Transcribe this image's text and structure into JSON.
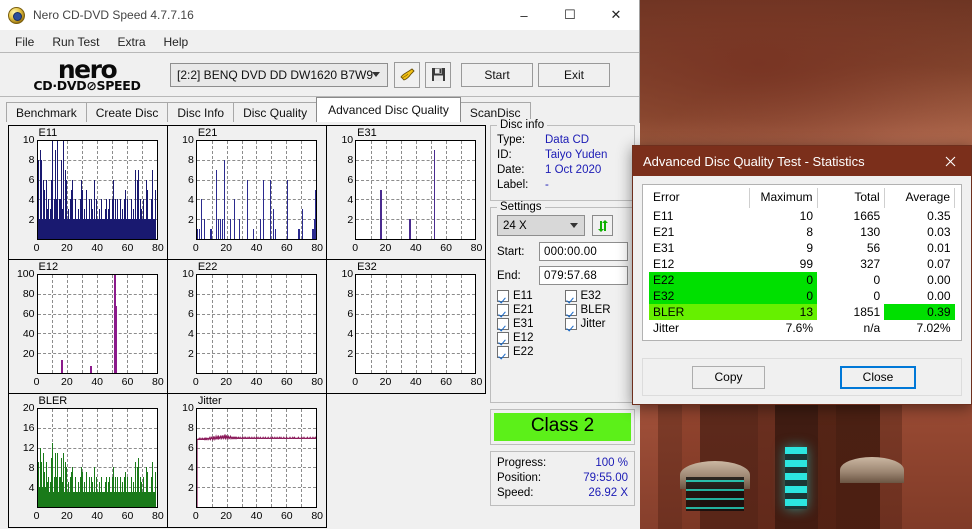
{
  "window": {
    "title": "Nero CD-DVD Speed 4.7.7.16",
    "icon": "nero-disc-icon",
    "minimize": "–",
    "maximize": "☐",
    "close": "✕"
  },
  "menubar": {
    "items": [
      "File",
      "Run Test",
      "Extra",
      "Help"
    ]
  },
  "toolbar": {
    "logo_line1": "nero",
    "logo_line2": "CD·DVD⊘SPEED",
    "drive": "[2:2]   BENQ DVD DD DW1620 B7W9",
    "icons": [
      "disc-scan-icon",
      "save-floppy-icon"
    ],
    "start_label": "Start",
    "exit_label": "Exit"
  },
  "tabs": [
    {
      "label": "Benchmark",
      "active": false
    },
    {
      "label": "Create Disc",
      "active": false
    },
    {
      "label": "Disc Info",
      "active": false
    },
    {
      "label": "Disc Quality",
      "active": false
    },
    {
      "label": "Advanced Disc Quality",
      "active": true
    },
    {
      "label": "ScanDisc",
      "active": false
    }
  ],
  "disc_info": {
    "legend": "Disc info",
    "rows": [
      {
        "key": "Type:",
        "value": "Data CD"
      },
      {
        "key": "ID:",
        "value": "Taiyo Yuden"
      },
      {
        "key": "Date:",
        "value": "1 Oct 2020"
      },
      {
        "key": "Label:",
        "value": "-"
      }
    ]
  },
  "settings": {
    "legend": "Settings",
    "speed": "24 X",
    "refresh_icon": "refresh-arrows-icon",
    "start_label": "Start:",
    "start_value": "000:00.00",
    "end_label": "End:",
    "end_value": "079:57.68",
    "checkboxes": [
      {
        "label": "E11",
        "checked": true
      },
      {
        "label": "E32",
        "checked": true
      },
      {
        "label": "E21",
        "checked": true
      },
      {
        "label": "BLER",
        "checked": true
      },
      {
        "label": "E31",
        "checked": true
      },
      {
        "label": "Jitter",
        "checked": true
      },
      {
        "label": "E12",
        "checked": true
      },
      {
        "label": "",
        "checked": null
      },
      {
        "label": "E22",
        "checked": true
      },
      {
        "label": "",
        "checked": null
      }
    ]
  },
  "class_box": {
    "label": "Class 2",
    "color": "#5cf019"
  },
  "progress_panel": {
    "rows": [
      {
        "key": "Progress:",
        "value": "100 %"
      },
      {
        "key": "Position:",
        "value": "79:55.00"
      },
      {
        "key": "Speed:",
        "value": "26.92 X"
      }
    ]
  },
  "stats_dialog": {
    "title": "Advanced Disc Quality Test - Statistics",
    "close_icon": "close-icon",
    "headers": [
      "Error",
      "Maximum",
      "Total",
      "Average"
    ],
    "rows": [
      {
        "error": "E11",
        "maximum": "10",
        "total": "1665",
        "average": "0.35",
        "hl": "none"
      },
      {
        "error": "E21",
        "maximum": "8",
        "total": "130",
        "average": "0.03",
        "hl": "none"
      },
      {
        "error": "E31",
        "maximum": "9",
        "total": "56",
        "average": "0.01",
        "hl": "none"
      },
      {
        "error": "E12",
        "maximum": "99",
        "total": "327",
        "average": "0.07",
        "hl": "none"
      },
      {
        "error": "E22",
        "maximum": "0",
        "total": "0",
        "average": "0.00",
        "hl": "left"
      },
      {
        "error": "E32",
        "maximum": "0",
        "total": "0",
        "average": "0.00",
        "hl": "left"
      },
      {
        "error": "BLER",
        "maximum": "13",
        "total": "1851",
        "average": "0.39",
        "hl": "bler"
      },
      {
        "error": "Jitter",
        "maximum": "7.6%",
        "total": "n/a",
        "average": "7.02%",
        "hl": "none"
      }
    ],
    "copy_label": "Copy",
    "close_label": "Close"
  },
  "chart_data": [
    {
      "id": "e11",
      "type": "bar",
      "title": "E11",
      "color": "#191970",
      "xlabel": "",
      "ylabel": "",
      "xlim": [
        0,
        80
      ],
      "ylim": [
        0,
        10
      ],
      "yticks": [
        2,
        4,
        6,
        8,
        10
      ],
      "xticks": [
        0,
        20,
        40,
        60,
        80
      ],
      "grid": true,
      "values": [
        4,
        8,
        2,
        2,
        9,
        7,
        8,
        2,
        2,
        2,
        6,
        2,
        1,
        5,
        2,
        2,
        2,
        6,
        2,
        3,
        4,
        4,
        2,
        2,
        3,
        2,
        6,
        2,
        2,
        10,
        2,
        2,
        4,
        2,
        9,
        4,
        2,
        2,
        10,
        2,
        2,
        1,
        4,
        2,
        4,
        2,
        8,
        3,
        2,
        2,
        10,
        2,
        2,
        7,
        2,
        2,
        6,
        2,
        2,
        1,
        3,
        2,
        2,
        4,
        5,
        2,
        2,
        6,
        2,
        2,
        2,
        2,
        4,
        2,
        2,
        2,
        2,
        2,
        3,
        1,
        2,
        2,
        4,
        2,
        2,
        6,
        2,
        5,
        2,
        2,
        2,
        3,
        2,
        2,
        5,
        2,
        2,
        2,
        1,
        2,
        4,
        2,
        2,
        2,
        4,
        2,
        3,
        2,
        2,
        2,
        6,
        2,
        2,
        4,
        2,
        2,
        2,
        2,
        1,
        2,
        3,
        2,
        2,
        4,
        2,
        2,
        1,
        2,
        2,
        2,
        2,
        3,
        2,
        4,
        2,
        2,
        3,
        2,
        2,
        4,
        2,
        1,
        2,
        2,
        4,
        2,
        2,
        6,
        2,
        2,
        4,
        2,
        2,
        2,
        4,
        2,
        1,
        2,
        2,
        2,
        4,
        2,
        2,
        3,
        2,
        2,
        2,
        4,
        2,
        2,
        5,
        2,
        2,
        2,
        4,
        2,
        2,
        2,
        2,
        1,
        2,
        2,
        4,
        2,
        2,
        2,
        3,
        2,
        2,
        7,
        2,
        2,
        6,
        2,
        2,
        7,
        2,
        2,
        4,
        2,
        2,
        3,
        2,
        2,
        2,
        4,
        2,
        2,
        2,
        2,
        6,
        2,
        2,
        5,
        2,
        2,
        2,
        1,
        2,
        2,
        4,
        2,
        2,
        7,
        2,
        2,
        2,
        5
      ]
    },
    {
      "id": "e21",
      "type": "bar",
      "title": "E21",
      "color": "#2b2b8f",
      "xlabel": "",
      "ylabel": "",
      "xlim": [
        0,
        80
      ],
      "ylim": [
        0,
        10
      ],
      "yticks": [
        2,
        4,
        6,
        8,
        10
      ],
      "xticks": [
        0,
        20,
        40,
        60,
        80
      ],
      "grid": true,
      "values": [
        0,
        1,
        0,
        0,
        1,
        0,
        0,
        4,
        0,
        0,
        0,
        0,
        0,
        2,
        0,
        0,
        0,
        0,
        0,
        0,
        0,
        0,
        0,
        0,
        1,
        0,
        0,
        1,
        0,
        0,
        0,
        0,
        0,
        0,
        0,
        0,
        7,
        0,
        0,
        2,
        0,
        0,
        0,
        2,
        0,
        0,
        0,
        0,
        2,
        0,
        0,
        0,
        8,
        0,
        0,
        0,
        0,
        0,
        0,
        0,
        0,
        0,
        0,
        2,
        0,
        0,
        0,
        0,
        0,
        0,
        4,
        0,
        0,
        0,
        0,
        0,
        0,
        0,
        0,
        0,
        2,
        0,
        0,
        0,
        0,
        0,
        0,
        0,
        0,
        0,
        0,
        0,
        0,
        0,
        6,
        0,
        0,
        0,
        0,
        0,
        0,
        0,
        0,
        0,
        0,
        1,
        0,
        0,
        0,
        0,
        0,
        0,
        0,
        0,
        0,
        0,
        0,
        0,
        0,
        2,
        0,
        0,
        0,
        0,
        0,
        6,
        0,
        0,
        0,
        0,
        0,
        0,
        0,
        0,
        0,
        0,
        0,
        0,
        6,
        0,
        0,
        0,
        0,
        3,
        0,
        0,
        0,
        0,
        1,
        0,
        0,
        0,
        0,
        0,
        0,
        0,
        0,
        0,
        0,
        0,
        0,
        0,
        0,
        0,
        0,
        0,
        0,
        0,
        0,
        6,
        0,
        0,
        0,
        0,
        0,
        0,
        0,
        0,
        0,
        0,
        0,
        0,
        0,
        0,
        0,
        0,
        0,
        0,
        0,
        0,
        1,
        0,
        0,
        1,
        0,
        0,
        0,
        0,
        3,
        0,
        0,
        0,
        0,
        0,
        0,
        0,
        0,
        0,
        0,
        0,
        0,
        0,
        0,
        0,
        0,
        0,
        0,
        1,
        0,
        1,
        0,
        2,
        5
      ]
    },
    {
      "id": "e31",
      "type": "bar",
      "title": "E31",
      "color": "#4a2b8f",
      "xlabel": "",
      "ylabel": "",
      "xlim": [
        0,
        80
      ],
      "ylim": [
        0,
        10
      ],
      "yticks": [
        2,
        4,
        6,
        8,
        10
      ],
      "xticks": [
        0,
        20,
        40,
        60,
        80
      ],
      "grid": true,
      "spikes": [
        {
          "x": 16,
          "y": 5
        },
        {
          "x": 35.5,
          "y": 2
        },
        {
          "x": 52,
          "y": 9
        }
      ]
    },
    {
      "id": "e12",
      "type": "bar",
      "title": "E12",
      "color": "#8b1a8b",
      "xlabel": "",
      "ylabel": "",
      "xlim": [
        0,
        80
      ],
      "ylim": [
        0,
        100
      ],
      "yticks": [
        20,
        40,
        60,
        80,
        100
      ],
      "xticks": [
        0,
        20,
        40,
        60,
        80
      ],
      "grid": true,
      "spikes": [
        {
          "x": 16,
          "y": 13
        },
        {
          "x": 35.5,
          "y": 7
        },
        {
          "x": 51.6,
          "y": 99
        },
        {
          "x": 52.4,
          "y": 68
        },
        {
          "x": 52.0,
          "y": 10
        }
      ]
    },
    {
      "id": "e22",
      "type": "bar",
      "title": "E22",
      "color": "#2b2b8f",
      "xlabel": "",
      "ylabel": "",
      "xlim": [
        0,
        80
      ],
      "ylim": [
        0,
        10
      ],
      "yticks": [
        2,
        4,
        6,
        8,
        10
      ],
      "xticks": [
        0,
        20,
        40,
        60,
        80
      ],
      "grid": true,
      "spikes": []
    },
    {
      "id": "e32",
      "type": "bar",
      "title": "E32",
      "color": "#2b2b8f",
      "xlabel": "",
      "ylabel": "",
      "xlim": [
        0,
        80
      ],
      "ylim": [
        0,
        10
      ],
      "yticks": [
        2,
        4,
        6,
        8,
        10
      ],
      "xticks": [
        0,
        20,
        40,
        60,
        80
      ],
      "grid": true,
      "spikes": []
    },
    {
      "id": "bler",
      "type": "bar",
      "title": "BLER",
      "color": "#1a7a1a",
      "xlabel": "",
      "ylabel": "",
      "xlim": [
        0,
        80
      ],
      "ylim": [
        0,
        20
      ],
      "yticks": [
        4,
        8,
        12,
        16,
        20
      ],
      "xticks": [
        0,
        20,
        40,
        60,
        80
      ],
      "grid": true,
      "values": [
        5,
        9,
        4,
        3,
        12,
        8,
        9,
        4,
        3,
        4,
        8,
        11,
        2,
        7,
        3,
        4,
        3,
        9,
        3,
        5,
        6,
        6,
        3,
        3,
        5,
        4,
        10,
        3,
        3,
        13,
        3,
        3,
        6,
        3,
        11,
        6,
        3,
        3,
        11,
        3,
        3,
        2,
        6,
        3,
        6,
        3,
        10,
        5,
        3,
        3,
        11,
        3,
        3,
        9,
        3,
        3,
        8,
        3,
        3,
        2,
        5,
        3,
        3,
        6,
        7,
        3,
        3,
        8,
        3,
        3,
        3,
        3,
        6,
        3,
        3,
        3,
        3,
        3,
        5,
        2,
        3,
        3,
        6,
        3,
        3,
        8,
        3,
        7,
        3,
        3,
        3,
        5,
        3,
        3,
        7,
        3,
        3,
        3,
        2,
        3,
        6,
        3,
        3,
        3,
        6,
        3,
        5,
        3,
        3,
        3,
        8,
        3,
        3,
        6,
        3,
        3,
        3,
        3,
        2,
        3,
        5,
        3,
        3,
        6,
        3,
        3,
        2,
        3,
        3,
        3,
        3,
        5,
        3,
        6,
        3,
        3,
        5,
        3,
        3,
        6,
        3,
        2,
        3,
        3,
        6,
        3,
        3,
        8,
        3,
        3,
        6,
        3,
        3,
        3,
        6,
        3,
        2,
        3,
        3,
        3,
        6,
        3,
        3,
        5,
        3,
        3,
        3,
        6,
        3,
        3,
        7,
        3,
        3,
        3,
        6,
        3,
        3,
        3,
        3,
        2,
        3,
        3,
        6,
        3,
        3,
        3,
        5,
        3,
        3,
        9,
        3,
        3,
        8,
        3,
        3,
        10,
        3,
        3,
        6,
        3,
        3,
        5,
        3,
        3,
        3,
        6,
        3,
        3,
        3,
        3,
        8,
        3,
        3,
        7,
        3,
        3,
        3,
        2,
        3,
        3,
        6,
        3,
        3,
        9,
        3,
        3,
        3,
        7
      ]
    },
    {
      "id": "jitter",
      "type": "line",
      "title": "Jitter",
      "color": "#8b1a5a",
      "xlabel": "",
      "ylabel": "",
      "xlim": [
        0,
        80
      ],
      "ylim": [
        0,
        10
      ],
      "yticks": [
        2,
        4,
        6,
        8,
        10
      ],
      "xticks": [
        0,
        20,
        40,
        60,
        80
      ],
      "grid": true,
      "values": [
        6.9,
        6.9,
        6.9,
        6.9,
        7.0,
        6.9,
        6.9,
        7.0,
        6.9,
        6.9,
        7.0,
        6.9,
        6.9,
        7.0,
        6.9,
        7.0,
        6.9,
        7.0,
        6.9,
        7.0,
        7.0,
        6.9,
        7.0,
        7.1,
        6.9,
        7.0,
        7.1,
        7.0,
        6.9,
        7.2,
        7.0,
        7.1,
        6.9,
        7.0,
        7.2,
        7.0,
        7.1,
        7.0,
        7.3,
        7.0,
        7.1,
        7.0,
        7.2,
        7.1,
        7.0,
        7.3,
        7.1,
        7.0,
        7.2,
        7.1,
        7.4,
        7.0,
        7.1,
        7.3,
        7.0,
        7.1,
        7.2,
        7.0,
        7.1,
        7.0,
        7.2,
        7.1,
        7.0,
        7.1,
        7.0,
        7.1,
        7.0,
        7.1,
        7.0,
        7.1,
        7.0,
        7.1,
        7.0,
        7.0,
        7.1,
        7.0,
        7.0,
        7.1,
        7.0,
        7.0,
        7.0,
        7.1,
        7.0,
        7.0,
        7.1,
        7.0,
        7.0,
        7.1,
        7.0,
        7.0,
        7.0,
        7.1,
        7.0,
        7.0,
        7.1,
        7.0,
        7.0,
        7.0,
        7.1,
        7.0,
        7.0,
        7.0,
        7.1,
        7.0,
        7.0,
        7.0,
        7.1,
        7.0,
        7.0,
        7.1,
        7.0,
        7.0,
        7.0,
        7.1,
        7.0,
        7.0,
        7.0,
        7.0,
        7.1,
        7.0,
        7.0,
        7.0,
        7.1,
        7.0,
        7.0,
        7.0,
        7.0,
        7.1,
        7.0,
        7.0,
        7.0,
        7.0,
        7.1,
        7.0,
        7.0,
        7.1,
        7.0,
        7.0,
        7.0,
        7.1,
        7.0,
        7.0,
        7.0,
        7.1,
        7.0,
        7.0,
        7.0,
        7.1,
        7.0,
        7.0,
        7.1,
        7.0,
        7.0,
        7.0,
        7.0,
        7.1,
        7.0,
        7.0,
        7.0,
        7.0,
        7.1,
        7.0,
        7.0,
        7.0,
        7.0,
        7.0,
        7.1,
        7.0,
        7.0,
        7.0,
        7.0,
        7.1,
        7.0,
        7.0,
        7.1,
        7.0,
        7.0,
        7.0,
        7.0,
        7.0,
        7.0,
        7.1,
        7.0,
        7.0,
        7.0,
        7.0,
        7.0,
        7.1,
        7.0,
        7.0,
        7.0,
        7.1,
        7.0,
        7.0,
        7.0,
        7.0,
        7.0,
        7.1,
        7.0,
        7.0,
        7.0,
        7.0,
        7.1,
        7.0,
        7.0,
        7.0,
        7.0,
        7.1,
        7.0,
        7.0,
        7.0,
        7.1,
        7.0,
        7.0
      ]
    }
  ]
}
